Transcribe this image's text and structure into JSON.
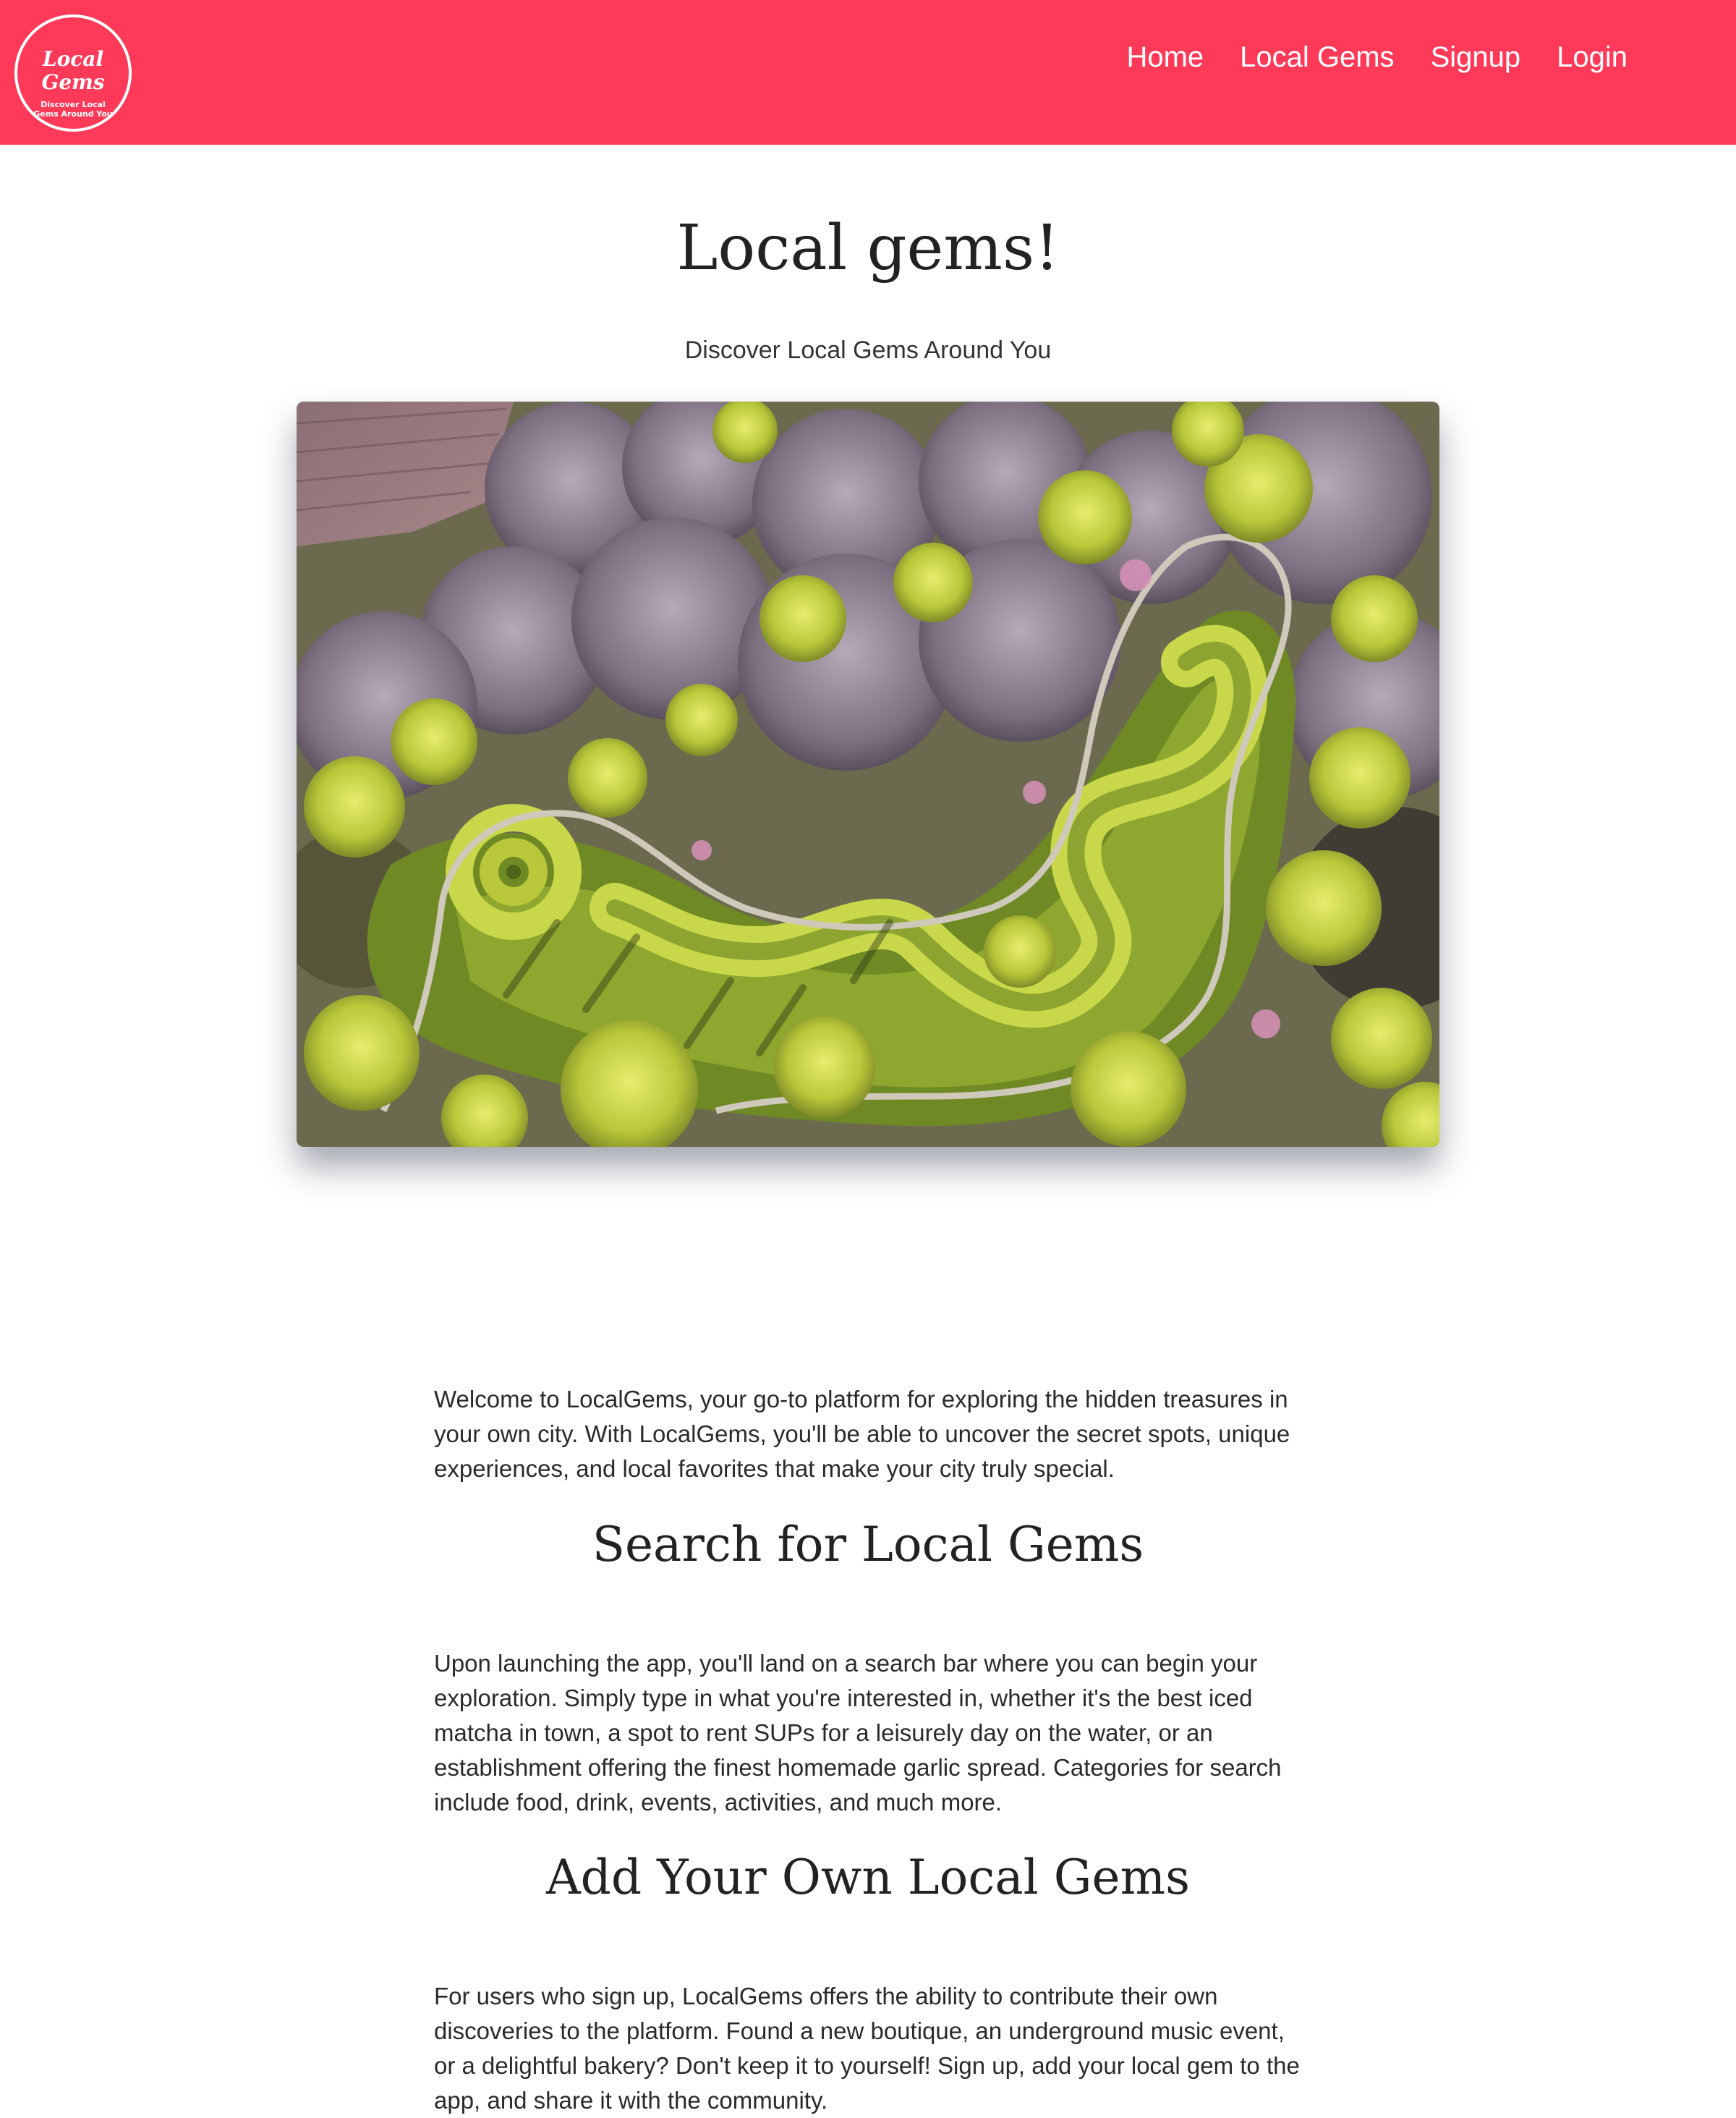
{
  "header": {
    "logo_script": "Local Gems",
    "logo_tagline": "Discover Local Gems Around You",
    "nav": [
      {
        "label": "Home"
      },
      {
        "label": "Local Gems"
      },
      {
        "label": "Signup"
      },
      {
        "label": "Login"
      }
    ],
    "colors": {
      "brand": "#ff3a59",
      "nav_text": "#ffffff"
    }
  },
  "main": {
    "title": "Local gems!",
    "subtitle": "Discover Local Gems Around You",
    "intro": "Welcome to LocalGems, your go-to platform for exploring the hidden treasures in your own city. With LocalGems, you'll be able to uncover the secret spots, unique experiences, and local favorites that make your city truly special.",
    "sections": [
      {
        "heading": "Search for Local Gems",
        "body": "Upon launching the app, you'll land on a search bar where you can begin your exploration. Simply type in what you're interested in, whether it's the best iced matcha in town, a spot to rent SUPs for a leisurely day on the water, or an establishment offering the finest homemade garlic spread. Categories for search include food, drink, events, activities, and much more."
      },
      {
        "heading": "Add Your Own Local Gems",
        "body": "For users who sign up, LocalGems offers the ability to contribute their own discoveries to the platform. Found a new boutique, an underground music event, or a delightful bakery? Don't keep it to yourself! Sign up, add your local gem to the app, and share it with the community."
      }
    ]
  }
}
